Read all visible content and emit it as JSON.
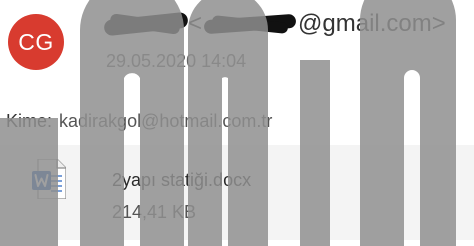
{
  "sender": {
    "avatar_initials": "CG",
    "avatar_color": "#d83b2f",
    "email_open": "<",
    "email_suffix": "@gmail.com>",
    "redacted": true
  },
  "message": {
    "date": "29.05.2020 14:04"
  },
  "recipient": {
    "label": "Kime:",
    "value": "kadirakgol@hotmail.com.tr"
  },
  "attachment": {
    "icon": "word-document-icon",
    "icon_color": "#185abd",
    "file_name": "2yapı statiği.docx",
    "file_size": "214,41 KB"
  },
  "overlay": {
    "watermark_color": "#8f8f8f"
  }
}
